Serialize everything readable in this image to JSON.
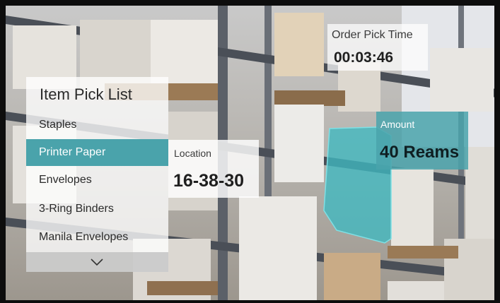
{
  "pick_list": {
    "title": "Item Pick List",
    "items": [
      {
        "label": "Staples",
        "selected": false
      },
      {
        "label": "Printer Paper",
        "selected": true
      },
      {
        "label": "Envelopes",
        "selected": false
      },
      {
        "label": "3-Ring Binders",
        "selected": false
      },
      {
        "label": "Manila Envelopes",
        "selected": false
      }
    ],
    "scroll_icon": "chevron-down-icon"
  },
  "location": {
    "label": "Location",
    "value": "16-38-30"
  },
  "pick_time": {
    "label": "Order Pick Time",
    "value": "00:03:46"
  },
  "amount": {
    "label": "Amount",
    "value": "40 Reams"
  },
  "colors": {
    "accent": "#4aa3ab",
    "highlight": "#3fb8c0"
  }
}
